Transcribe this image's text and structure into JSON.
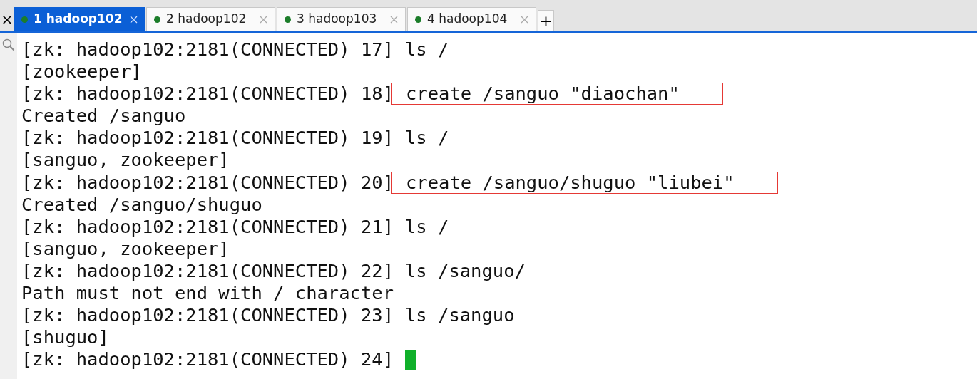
{
  "tabs": [
    {
      "number": "1",
      "label": "hadoop102",
      "selected": true
    },
    {
      "number": "2",
      "label": "hadoop102",
      "selected": false
    },
    {
      "number": "3",
      "label": "hadoop103",
      "selected": false
    },
    {
      "number": "4",
      "label": "hadoop104",
      "selected": false
    }
  ],
  "new_tab": "+",
  "close_all": "×",
  "lines": [
    {
      "kind": "prompt",
      "prompt": "[zk: hadoop102:2181(CONNECTED) 17]",
      "command": "ls /",
      "highlighted": false
    },
    {
      "kind": "output",
      "text": "[zookeeper]"
    },
    {
      "kind": "prompt",
      "prompt": "[zk: hadoop102:2181(CONNECTED) 18]",
      "command": "create /sanguo \"diaochan\"",
      "highlighted": true
    },
    {
      "kind": "output",
      "text": "Created /sanguo"
    },
    {
      "kind": "prompt",
      "prompt": "[zk: hadoop102:2181(CONNECTED) 19]",
      "command": "ls /",
      "highlighted": false
    },
    {
      "kind": "output",
      "text": "[sanguo, zookeeper]"
    },
    {
      "kind": "prompt",
      "prompt": "[zk: hadoop102:2181(CONNECTED) 20]",
      "command": "create /sanguo/shuguo \"liubei\"",
      "highlighted": true
    },
    {
      "kind": "output",
      "text": "Created /sanguo/shuguo"
    },
    {
      "kind": "prompt",
      "prompt": "[zk: hadoop102:2181(CONNECTED) 21]",
      "command": "ls /",
      "highlighted": false
    },
    {
      "kind": "output",
      "text": "[sanguo, zookeeper]"
    },
    {
      "kind": "prompt",
      "prompt": "[zk: hadoop102:2181(CONNECTED) 22]",
      "command": "ls /sanguo/",
      "highlighted": false
    },
    {
      "kind": "output",
      "text": "Path must not end with / character"
    },
    {
      "kind": "prompt",
      "prompt": "[zk: hadoop102:2181(CONNECTED) 23]",
      "command": "ls /sanguo",
      "highlighted": false
    },
    {
      "kind": "output",
      "text": "[shuguo]"
    },
    {
      "kind": "cursor",
      "prompt": "[zk: hadoop102:2181(CONNECTED) 24]"
    }
  ]
}
